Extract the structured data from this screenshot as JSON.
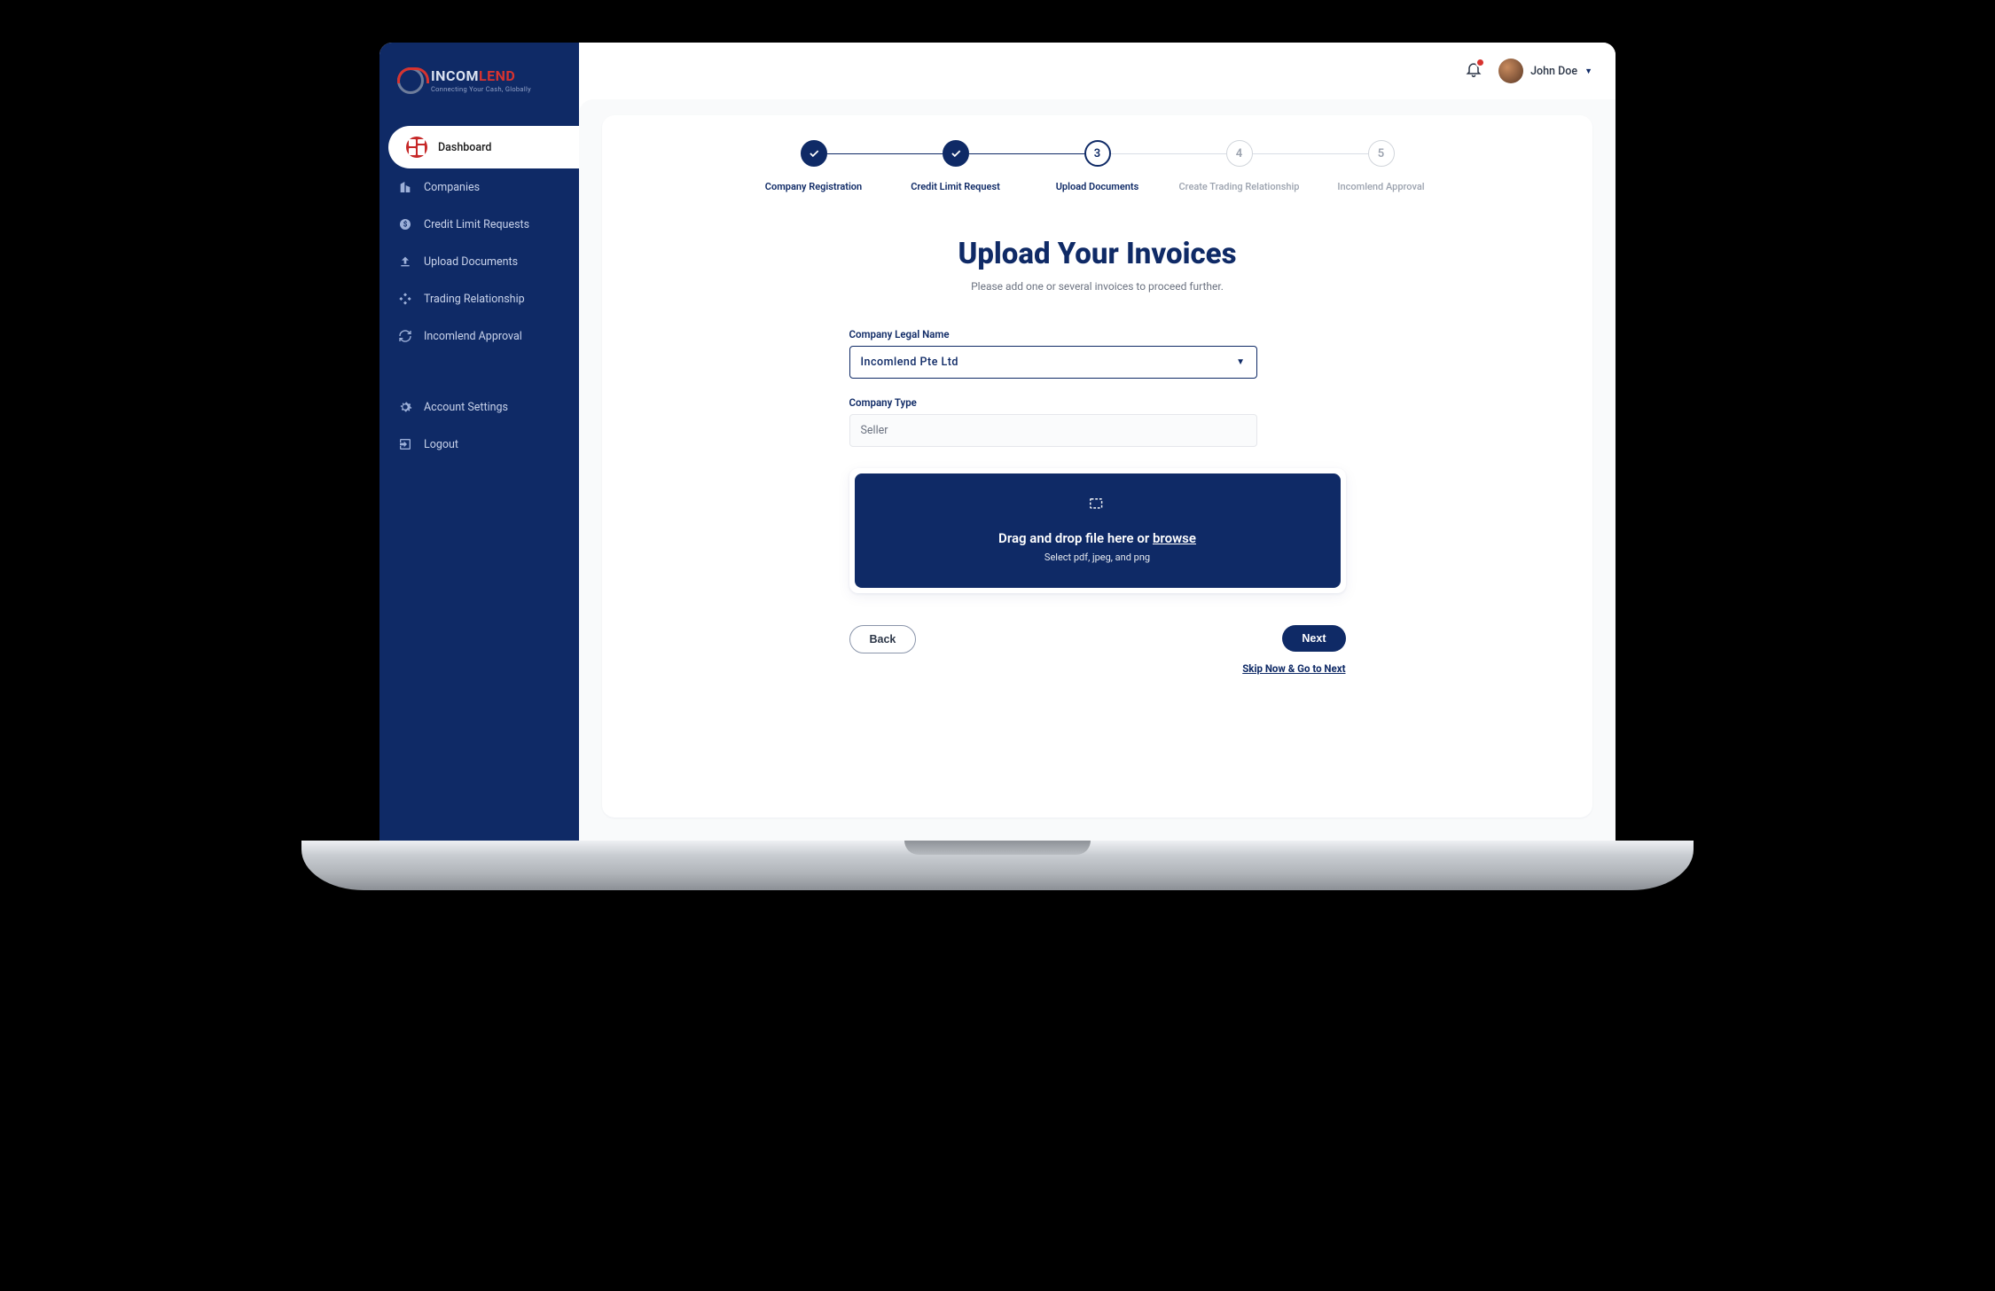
{
  "brand": {
    "name_a": "INCOM",
    "name_b": "LEND",
    "tagline": "Connecting Your Cash, Globally"
  },
  "sidebar": {
    "items": [
      {
        "label": "Dashboard",
        "icon": "dashboard-icon",
        "active": true
      },
      {
        "label": "Companies",
        "icon": "building-icon",
        "active": false
      },
      {
        "label": "Credit Limit Requests",
        "icon": "dollar-icon",
        "active": false
      },
      {
        "label": "Upload Documents",
        "icon": "upload-icon",
        "active": false
      },
      {
        "label": "Trading Relationship",
        "icon": "handshake-icon",
        "active": false
      },
      {
        "label": "Incomlend Approval",
        "icon": "refresh-icon",
        "active": false
      }
    ],
    "footer": [
      {
        "label": "Account Settings",
        "icon": "gear-icon"
      },
      {
        "label": "Logout",
        "icon": "logout-icon"
      }
    ]
  },
  "header": {
    "user_name": "John Doe",
    "has_notification": true
  },
  "stepper": {
    "steps": [
      {
        "label": "Company Registration",
        "state": "done"
      },
      {
        "label": "Credit Limit Request",
        "state": "done"
      },
      {
        "label": "Upload Documents",
        "state": "current",
        "number": "3"
      },
      {
        "label": "Create Trading Relationship",
        "state": "future",
        "number": "4"
      },
      {
        "label": "Incomlend Approval",
        "state": "future",
        "number": "5"
      }
    ]
  },
  "page": {
    "title": "Upload Your Invoices",
    "subtitle": "Please add one or several invoices to proceed further."
  },
  "form": {
    "company_legal_name_label": "Company Legal Name",
    "company_legal_name_value": "Incomlend Pte Ltd",
    "company_type_label": "Company Type",
    "company_type_value": "Seller"
  },
  "dropzone": {
    "text_a": "Drag and drop file here or ",
    "browse": "browse",
    "sub": "Select pdf, jpeg, and png"
  },
  "actions": {
    "back": "Back",
    "next": "Next",
    "skip": "Skip Now & Go to Next"
  }
}
